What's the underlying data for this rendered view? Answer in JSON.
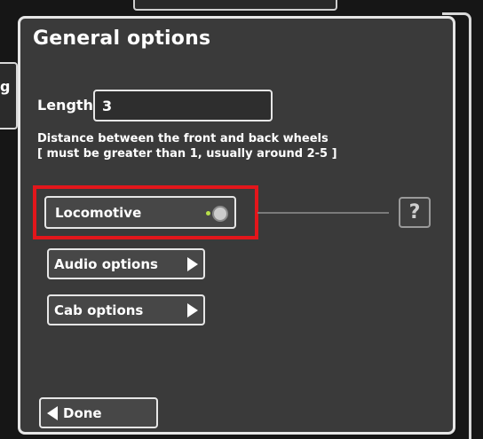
{
  "background": {
    "left_tab_text": "g"
  },
  "panel": {
    "title": "General options",
    "length": {
      "label": "Length",
      "value": "3"
    },
    "description_line1": "Distance between the front and back wheels",
    "description_line2": "[ must be greater than 1, usually around 2-5 ]",
    "locomotive_toggle": {
      "label": "Locomotive",
      "state": "off"
    },
    "help_button": "?",
    "audio_options": "Audio options",
    "cab_options": "Cab options",
    "done": "Done"
  },
  "colors": {
    "panel_bg": "#3a3a3a",
    "border": "#e6e6e6",
    "highlight": "#e3161b",
    "led": "#b8e04a"
  }
}
